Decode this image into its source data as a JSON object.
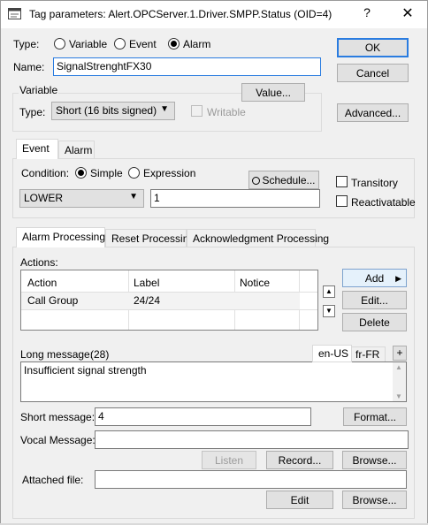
{
  "window": {
    "title": "Tag parameters: Alert.OPCServer.1.Driver.SMPP.Status (OID=4)",
    "help_symbol": "?",
    "close_symbol": "✕"
  },
  "type_row": {
    "label": "Type:",
    "options": [
      "Variable",
      "Event",
      "Alarm"
    ],
    "selected": "Alarm"
  },
  "name": {
    "label": "Name:",
    "value": "SignalStrenghtFX30"
  },
  "buttons": {
    "ok": "OK",
    "cancel": "Cancel",
    "advanced": "Advanced..."
  },
  "variable": {
    "group_label": "Variable",
    "value_button": "Value...",
    "type_label": "Type:",
    "type_value": "Short (16 bits signed)",
    "writable_label": "Writable"
  },
  "event_tabs": [
    "Event",
    "Alarm"
  ],
  "condition": {
    "label": "Condition:",
    "simple": "Simple",
    "expression": "Expression",
    "schedule_button": "Schedule...",
    "operator": "LOWER",
    "value": "1",
    "transitory": "Transitory",
    "reactivatable": "Reactivatable"
  },
  "processing_tabs": [
    "Alarm Processing",
    "Reset Processing",
    "Acknowledgment Processing"
  ],
  "actions": {
    "label": "Actions:",
    "columns": [
      "Action",
      "Label",
      "Notice"
    ],
    "rows": [
      {
        "action": "Call Group",
        "label": "24/24",
        "notice": ""
      }
    ],
    "add": "Add",
    "edit": "Edit...",
    "delete": "Delete"
  },
  "long_message": {
    "label": "Long message:",
    "count": "(28)",
    "lang_active": "en-US",
    "lang_other": "fr-FR",
    "plus": "+",
    "text": "Insufficient signal strength"
  },
  "short_message": {
    "label": "Short message:",
    "value": "4",
    "format_button": "Format..."
  },
  "vocal": {
    "label": "Vocal Message:",
    "listen": "Listen",
    "record": "Record...",
    "browse": "Browse..."
  },
  "attached": {
    "label": "Attached file:",
    "edit": "Edit",
    "browse": "Browse..."
  },
  "colors": {
    "accent": "#2a7ce0",
    "face": "#f0f0f0",
    "button": "#e1e1e1"
  }
}
